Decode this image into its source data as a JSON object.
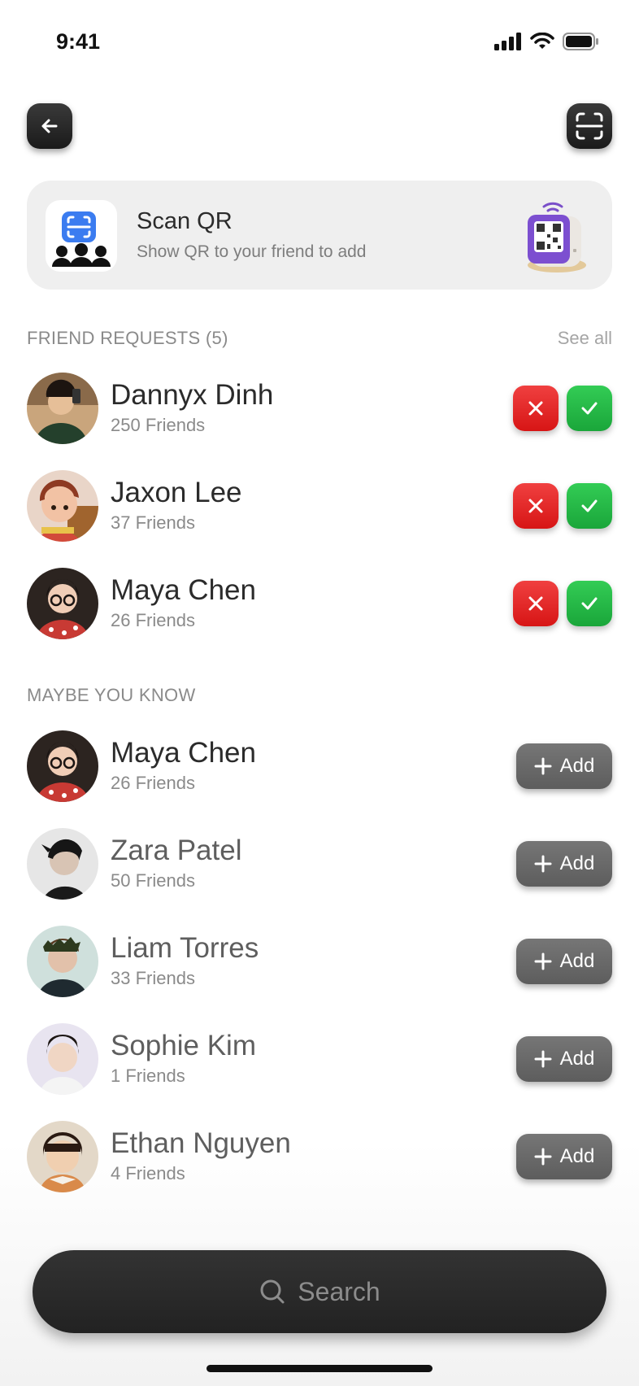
{
  "status_bar": {
    "time": "9:41"
  },
  "scan_card": {
    "title": "Scan QR",
    "subtitle": "Show QR to your friend to add"
  },
  "friend_requests": {
    "label": "FRIEND REQUESTS (5)",
    "see_all": "See all",
    "items": [
      {
        "name": "Dannyx Dinh",
        "friends": "250 Friends"
      },
      {
        "name": "Jaxon Lee",
        "friends": "37 Friends"
      },
      {
        "name": "Maya Chen",
        "friends": "26 Friends"
      }
    ]
  },
  "maybe_you_know": {
    "label": "MAYBE YOU KNOW",
    "add_label": "Add",
    "items": [
      {
        "name": "Maya Chen",
        "friends": "26 Friends"
      },
      {
        "name": "Zara Patel",
        "friends": "50 Friends"
      },
      {
        "name": "Liam Torres",
        "friends": "33 Friends"
      },
      {
        "name": "Sophie Kim",
        "friends": "1 Friends"
      },
      {
        "name": "Ethan Nguyen",
        "friends": "4 Friends"
      }
    ]
  },
  "search": {
    "placeholder": "Search"
  },
  "colors": {
    "reject": "#e02020",
    "accept": "#22b544",
    "dark": "#2a2a2a",
    "card": "#efefef",
    "scan_accent": "#3b7cf0"
  }
}
